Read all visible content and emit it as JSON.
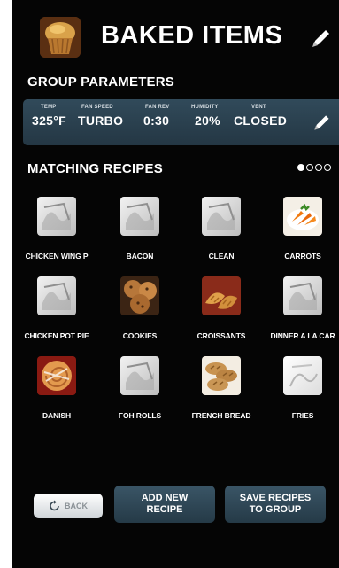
{
  "header": {
    "title": "BAKED ITEMS",
    "thumb_icon": "muffin-icon",
    "edit_icon": "pencil-icon"
  },
  "group_parameters": {
    "heading": "GROUP PARAMETERS",
    "params": [
      {
        "label": "TEMP",
        "value": "325°F"
      },
      {
        "label": "FAN SPEED",
        "value": "TURBO"
      },
      {
        "label": "FAN REV",
        "value": "0:30"
      },
      {
        "label": "HUMIDITY",
        "value": "20%"
      },
      {
        "label": "VENT",
        "value": "CLOSED"
      }
    ],
    "edit_icon": "pencil-icon"
  },
  "recipes": {
    "heading": "MATCHING RECIPES",
    "pager": {
      "pages": 4,
      "current": 1
    },
    "items": [
      {
        "label": "CHICKEN WING P",
        "image": "placeholder"
      },
      {
        "label": "BACON",
        "image": "placeholder"
      },
      {
        "label": "CLEAN",
        "image": "placeholder"
      },
      {
        "label": "CARROTS",
        "image": "carrots"
      },
      {
        "label": "CHICKEN POT PIE",
        "image": "placeholder"
      },
      {
        "label": "COOKIES",
        "image": "cookies"
      },
      {
        "label": "CROISSANTS",
        "image": "croissants"
      },
      {
        "label": "DINNER A LA CAR",
        "image": "placeholder"
      },
      {
        "label": "DANISH",
        "image": "danish"
      },
      {
        "label": "FOH ROLLS",
        "image": "placeholder"
      },
      {
        "label": "FRENCH BREAD",
        "image": "french-bread"
      },
      {
        "label": "FRIES",
        "image": "placeholder"
      }
    ]
  },
  "actions": {
    "back_label": "BACK",
    "add_new_line1": "ADD NEW",
    "add_new_line2": "RECIPE",
    "save_line1": "SAVE RECIPES",
    "save_line2": "TO GROUP"
  },
  "colors": {
    "background": "#050505",
    "panel": "#2a404e",
    "button": "#2f4856",
    "back_button": "#e9ecee"
  }
}
